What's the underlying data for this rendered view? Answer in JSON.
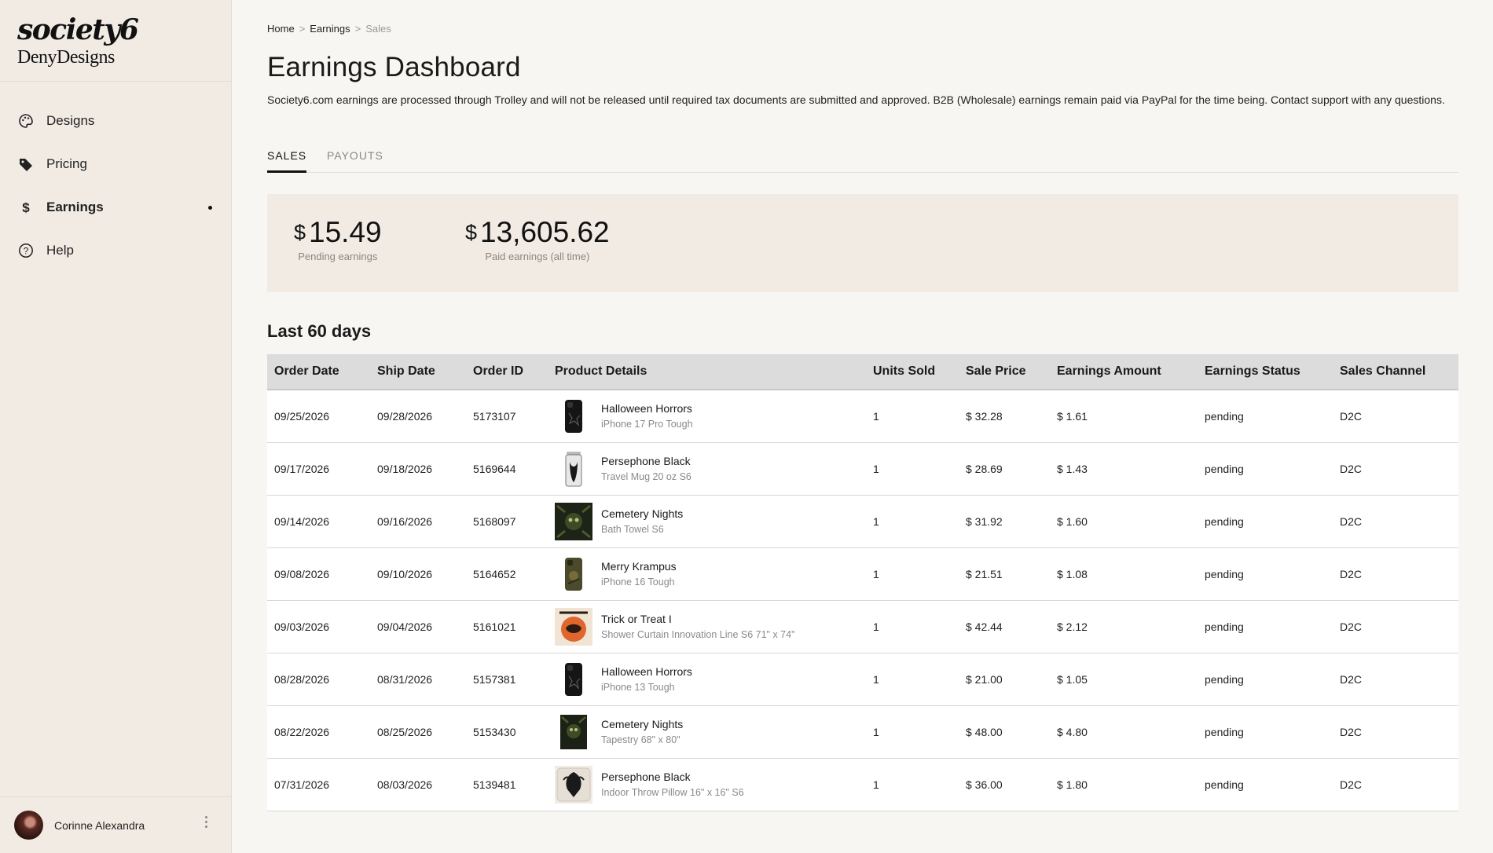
{
  "brand": {
    "logo": "society6",
    "store": "DenyDesigns"
  },
  "nav": [
    {
      "label": "Designs",
      "icon": "palette-icon"
    },
    {
      "label": "Pricing",
      "icon": "price-tag-icon"
    },
    {
      "label": "Earnings",
      "icon": "dollar-icon",
      "active": true
    },
    {
      "label": "Help",
      "icon": "help-circle-icon"
    }
  ],
  "user": {
    "name": "Corinne Alexandra"
  },
  "breadcrumb": {
    "home": "Home",
    "earnings": "Earnings",
    "current": "Sales",
    "separator": ">"
  },
  "page": {
    "title": "Earnings Dashboard",
    "intro": "Society6.com earnings are processed through Trolley and will not be released until required tax documents are submitted and approved. B2B (Wholesale) earnings remain paid via PayPal for the time being. Contact support with any questions."
  },
  "tabs": {
    "sales": "SALES",
    "payouts": "PAYOUTS",
    "active": "SALES"
  },
  "summary": {
    "currency": "$",
    "pending_value": "15.49",
    "pending_label": "Pending earnings",
    "paid_value": "13,605.62",
    "paid_label": "Paid earnings (all time)"
  },
  "section_title": "Last 60 days",
  "table": {
    "headers": [
      "Order Date",
      "Ship Date",
      "Order ID",
      "Product Details",
      "Units Sold",
      "Sale Price",
      "Earnings Amount",
      "Earnings Status",
      "Sales Channel"
    ],
    "rows": [
      {
        "order_date": "09/25/2026",
        "ship_date": "09/28/2026",
        "order_id": "5173107",
        "product": "Halloween Horrors",
        "product_type": "iPhone 17 Pro Tough",
        "units": "1",
        "sale_price": "$ 32.28",
        "earnings": "$ 1.61",
        "status": "pending",
        "channel": "D2C",
        "thumb": "phone-case"
      },
      {
        "order_date": "09/17/2026",
        "ship_date": "09/18/2026",
        "order_id": "5169644",
        "product": "Persephone Black",
        "product_type": "Travel Mug 20 oz S6",
        "units": "1",
        "sale_price": "$ 28.69",
        "earnings": "$ 1.43",
        "status": "pending",
        "channel": "D2C",
        "thumb": "mug"
      },
      {
        "order_date": "09/14/2026",
        "ship_date": "09/16/2026",
        "order_id": "5168097",
        "product": "Cemetery Nights",
        "product_type": "Bath Towel S6",
        "units": "1",
        "sale_price": "$ 31.92",
        "earnings": "$ 1.60",
        "status": "pending",
        "channel": "D2C",
        "thumb": "towel"
      },
      {
        "order_date": "09/08/2026",
        "ship_date": "09/10/2026",
        "order_id": "5164652",
        "product": "Merry Krampus",
        "product_type": "iPhone 16 Tough",
        "units": "1",
        "sale_price": "$ 21.51",
        "earnings": "$ 1.08",
        "status": "pending",
        "channel": "D2C",
        "thumb": "phone-case-green"
      },
      {
        "order_date": "09/03/2026",
        "ship_date": "09/04/2026",
        "order_id": "5161021",
        "product": "Trick or Treat I",
        "product_type": "Shower Curtain Innovation Line S6 71\" x 74\"",
        "units": "1",
        "sale_price": "$ 42.44",
        "earnings": "$ 2.12",
        "status": "pending",
        "channel": "D2C",
        "thumb": "curtain"
      },
      {
        "order_date": "08/28/2026",
        "ship_date": "08/31/2026",
        "order_id": "5157381",
        "product": "Halloween Horrors",
        "product_type": "iPhone 13 Tough",
        "units": "1",
        "sale_price": "$ 21.00",
        "earnings": "$ 1.05",
        "status": "pending",
        "channel": "D2C",
        "thumb": "phone-case"
      },
      {
        "order_date": "08/22/2026",
        "ship_date": "08/25/2026",
        "order_id": "5153430",
        "product": "Cemetery Nights",
        "product_type": "Tapestry 68\" x 80\"",
        "units": "1",
        "sale_price": "$ 48.00",
        "earnings": "$ 4.80",
        "status": "pending",
        "channel": "D2C",
        "thumb": "tapestry"
      },
      {
        "order_date": "07/31/2026",
        "ship_date": "08/03/2026",
        "order_id": "5139481",
        "product": "Persephone Black",
        "product_type": "Indoor Throw Pillow 16\" x 16\" S6",
        "units": "1",
        "sale_price": "$ 36.00",
        "earnings": "$ 1.80",
        "status": "pending",
        "channel": "D2C",
        "thumb": "pillow"
      }
    ]
  }
}
